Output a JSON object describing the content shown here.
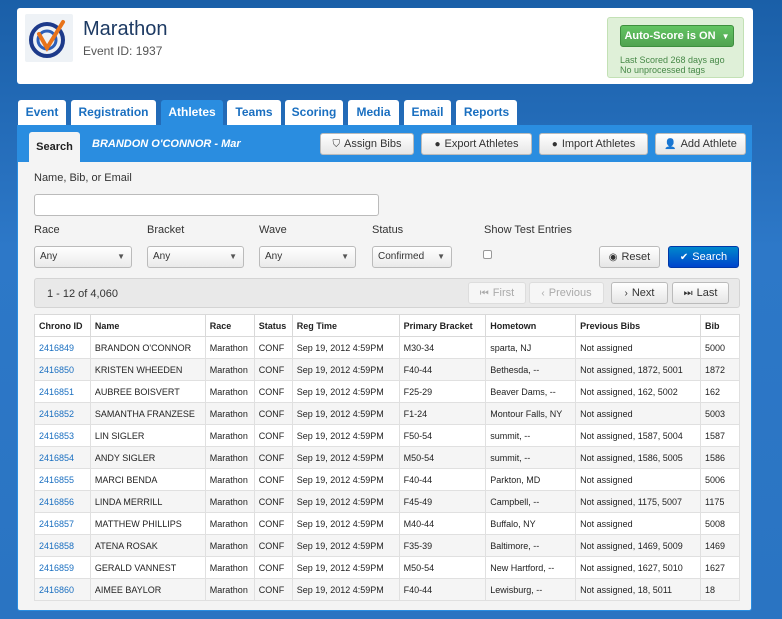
{
  "header": {
    "title": "Marathon",
    "event_id": "Event ID: 1937",
    "autoscore_label": "Auto-Score is ON",
    "last_scored": "Last Scored 268 days ago",
    "unprocessed": "No unprocessed tags"
  },
  "tabs": [
    {
      "label": "Event"
    },
    {
      "label": "Registration"
    },
    {
      "label": "Athletes"
    },
    {
      "label": "Teams"
    },
    {
      "label": "Scoring"
    },
    {
      "label": "Media"
    },
    {
      "label": "Email"
    },
    {
      "label": "Reports"
    }
  ],
  "panel": {
    "search_tab": "Search",
    "athlete_name": "BRANDON O'CONNOR - Mar",
    "buttons": {
      "assign_bibs": "Assign Bibs",
      "export_athletes": "Export Athletes",
      "import_athletes": "Import Athletes",
      "add_athlete": "Add Athlete"
    }
  },
  "filters": {
    "name_label": "Name, Bib, or Email",
    "name_value": "",
    "race_label": "Race",
    "race_value": "Any",
    "bracket_label": "Bracket",
    "bracket_value": "Any",
    "wave_label": "Wave",
    "wave_value": "Any",
    "status_label": "Status",
    "status_value": "Confirmed",
    "test_label": "Show Test Entries",
    "reset_label": "Reset",
    "search_label": "Search"
  },
  "pager": {
    "count": "1 - 12 of 4,060",
    "first": "First",
    "previous": "Previous",
    "next": "Next",
    "last": "Last"
  },
  "table": {
    "headers": [
      "Chrono ID",
      "Name",
      "Race",
      "Status",
      "Reg Time",
      "Primary Bracket",
      "Hometown",
      "Previous Bibs",
      "Bib"
    ],
    "rows": [
      [
        "2416849",
        "BRANDON O'CONNOR",
        "Marathon",
        "CONF",
        "Sep 19, 2012 4:59PM",
        "M30-34",
        "sparta, NJ",
        "Not assigned",
        "5000"
      ],
      [
        "2416850",
        "KRISTEN WHEEDEN",
        "Marathon",
        "CONF",
        "Sep 19, 2012 4:59PM",
        "F40-44",
        "Bethesda, --",
        "Not assigned, 1872, 5001",
        "1872"
      ],
      [
        "2416851",
        "AUBREE BOISVERT",
        "Marathon",
        "CONF",
        "Sep 19, 2012 4:59PM",
        "F25-29",
        "Beaver Dams, --",
        "Not assigned, 162, 5002",
        "162"
      ],
      [
        "2416852",
        "SAMANTHA FRANZESE",
        "Marathon",
        "CONF",
        "Sep 19, 2012 4:59PM",
        "F1-24",
        "Montour Falls, NY",
        "Not assigned",
        "5003"
      ],
      [
        "2416853",
        "LIN SIGLER",
        "Marathon",
        "CONF",
        "Sep 19, 2012 4:59PM",
        "F50-54",
        "summit, --",
        "Not assigned, 1587, 5004",
        "1587"
      ],
      [
        "2416854",
        "ANDY SIGLER",
        "Marathon",
        "CONF",
        "Sep 19, 2012 4:59PM",
        "M50-54",
        "summit, --",
        "Not assigned, 1586, 5005",
        "1586"
      ],
      [
        "2416855",
        "MARCI BENDA",
        "Marathon",
        "CONF",
        "Sep 19, 2012 4:59PM",
        "F40-44",
        "Parkton, MD",
        "Not assigned",
        "5006"
      ],
      [
        "2416856",
        "LINDA MERRILL",
        "Marathon",
        "CONF",
        "Sep 19, 2012 4:59PM",
        "F45-49",
        "Campbell, --",
        "Not assigned, 1175, 5007",
        "1175"
      ],
      [
        "2416857",
        "MATTHEW PHILLIPS",
        "Marathon",
        "CONF",
        "Sep 19, 2012 4:59PM",
        "M40-44",
        "Buffalo, NY",
        "Not assigned",
        "5008"
      ],
      [
        "2416858",
        "ATENA ROSAK",
        "Marathon",
        "CONF",
        "Sep 19, 2012 4:59PM",
        "F35-39",
        "Baltimore, --",
        "Not assigned, 1469, 5009",
        "1469"
      ],
      [
        "2416859",
        "GERALD VANNEST",
        "Marathon",
        "CONF",
        "Sep 19, 2012 4:59PM",
        "M50-54",
        "New Hartford, --",
        "Not assigned, 1627, 5010",
        "1627"
      ],
      [
        "2416860",
        "AIMEE BAYLOR",
        "Marathon",
        "CONF",
        "Sep 19, 2012 4:59PM",
        "F40-44",
        "Lewisburg, --",
        "Not assigned, 18, 5011",
        "18"
      ]
    ]
  },
  "colors": {
    "accent": "#2a8de0",
    "link": "#1a6fc0",
    "success": "#51a351",
    "primary": "#0055cc"
  }
}
